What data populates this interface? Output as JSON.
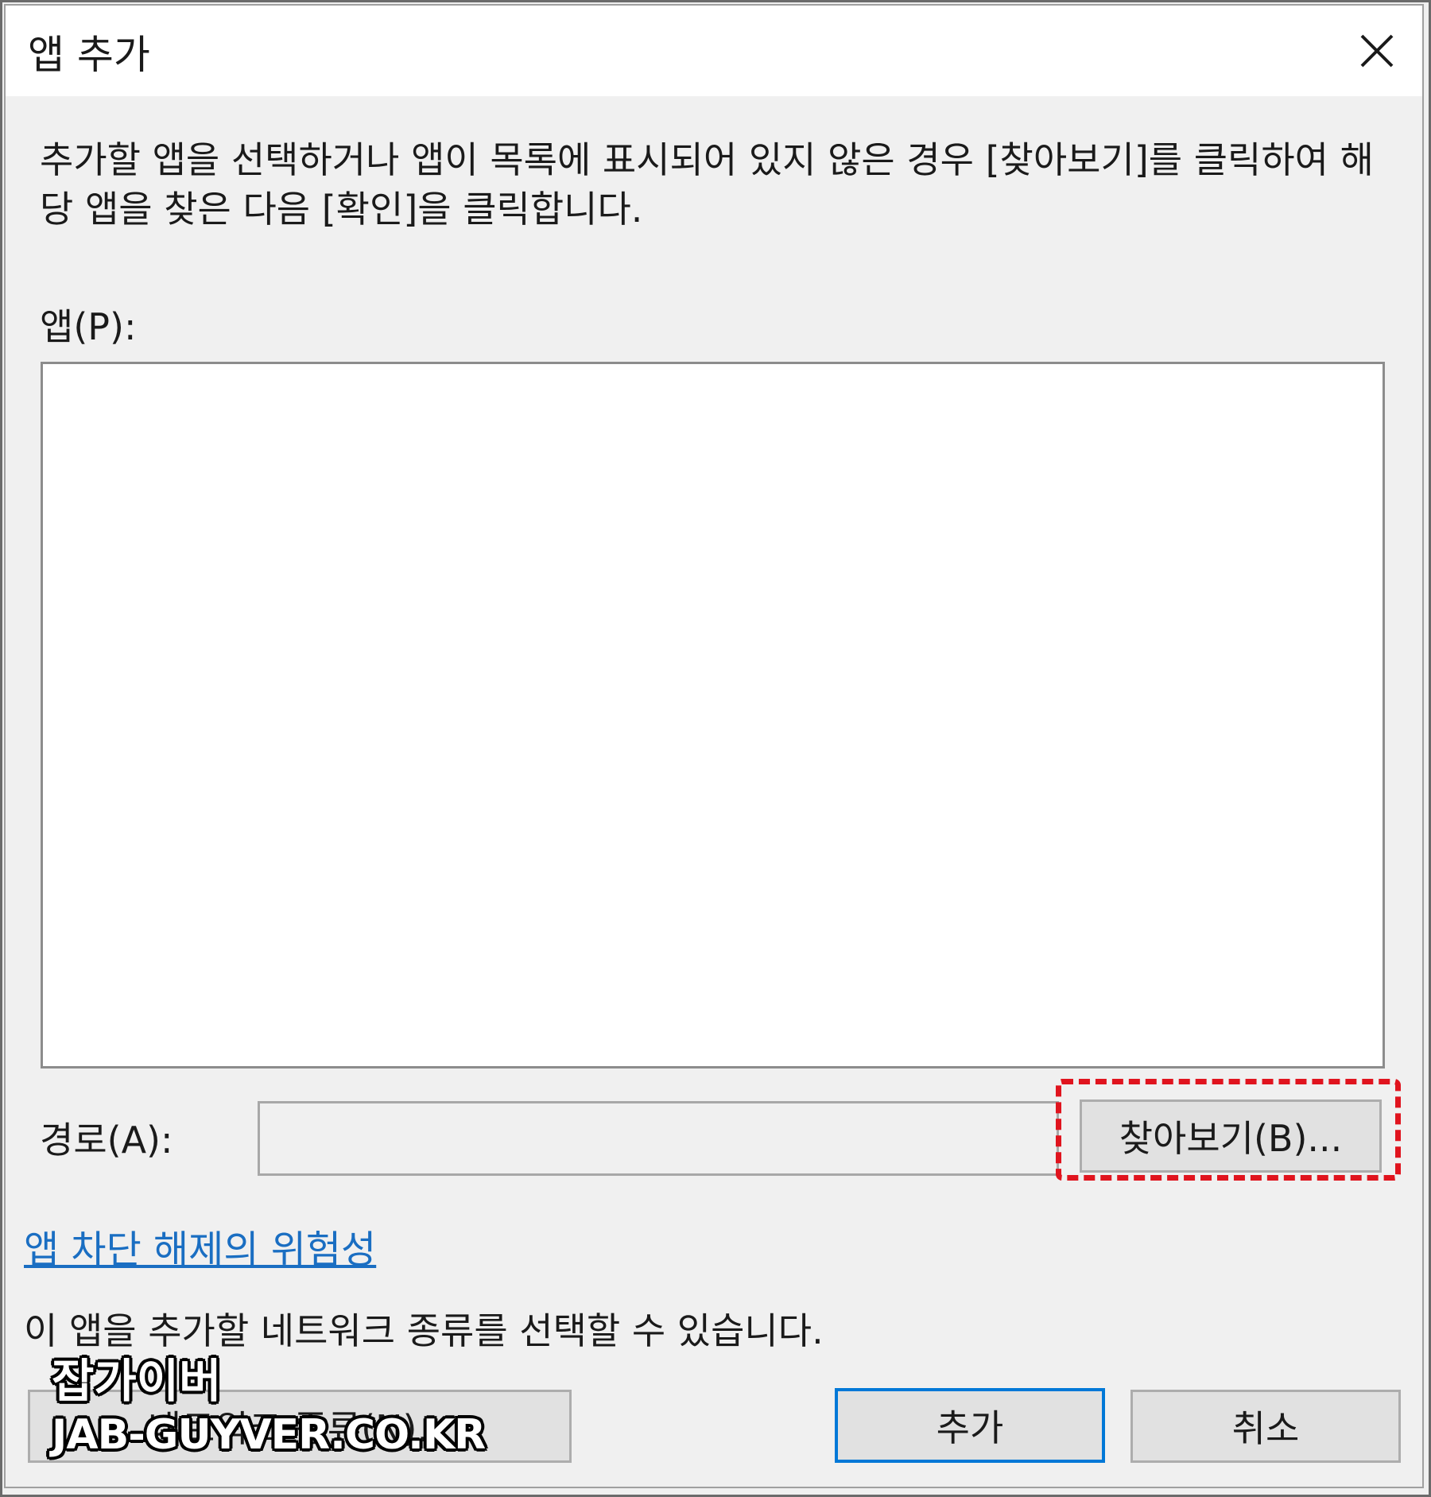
{
  "dialog": {
    "title": "앱 추가",
    "close_icon": "close-icon",
    "description": "추가할 앱을 선택하거나 앱이 목록에 표시되어 있지 않은 경우 [찾아보기]를 클릭하여 해당 앱을 찾은 다음 [확인]을 클릭합니다.",
    "app_label": "앱(P):",
    "path_label": "경로(A):",
    "path_value": "",
    "browse_label": "찾아보기(B)...",
    "risk_link": "앱 차단 해제의 위험성",
    "network_text": "이 앱을 추가할 네트워크 종류를 선택할 수 있습니다.",
    "network_button_label": "네트워크 종류(N)...",
    "add_label": "추가",
    "cancel_label": "취소",
    "highlight_color": "#e0141e",
    "link_color": "#1a6ec2"
  },
  "watermark": {
    "name": "잡가이버",
    "url": "JAB-GUYVER.CO.KR"
  }
}
